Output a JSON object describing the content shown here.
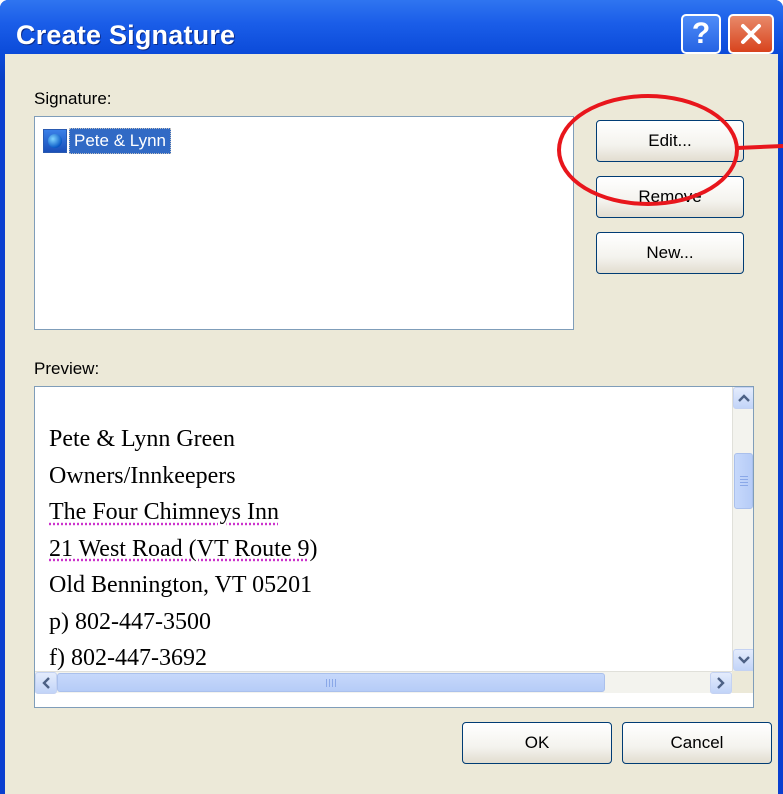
{
  "window": {
    "title": "Create Signature",
    "help_glyph": "?",
    "close_glyph": "close-icon"
  },
  "signature": {
    "label": "Signature:",
    "items": [
      {
        "label": "Pete & Lynn",
        "icon": "signature-globe-icon",
        "selected": true
      }
    ]
  },
  "buttons": {
    "edit": "Edit...",
    "remove": "Remove",
    "new": "New...",
    "ok": "OK",
    "cancel": "Cancel"
  },
  "preview": {
    "label": "Preview:",
    "lines": [
      "Pete & Lynn Green",
      "Owners/Innkeepers",
      "The Four Chimneys Inn",
      "21 West Road (VT Route 9)",
      "Old Bennington, VT 05201",
      "p) 802-447-3500",
      "f) 802-447-3692"
    ]
  },
  "annotation": {
    "color": "#e8161c"
  },
  "colors": {
    "selection": "#316ac5",
    "titlebar": "#0a49d8",
    "dialog_bg": "#ece9d8"
  }
}
